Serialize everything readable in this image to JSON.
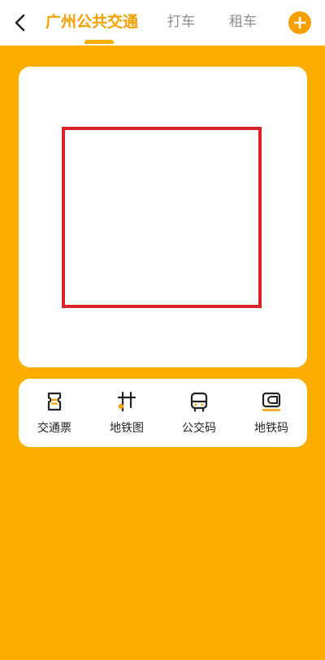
{
  "header": {
    "back_icon": "chevron-left-icon",
    "tabs": [
      {
        "label": "广州公共交通",
        "active": true
      },
      {
        "label": "打车",
        "active": false
      },
      {
        "label": "租车",
        "active": false
      }
    ],
    "add_icon": "plus-circle-icon"
  },
  "menu": {
    "items": [
      {
        "label": "交通票",
        "icon": "ticket-icon"
      },
      {
        "label": "地铁图",
        "icon": "metro-map-icon"
      },
      {
        "label": "公交码",
        "icon": "bus-icon"
      },
      {
        "label": "地铁码",
        "icon": "metro-card-icon"
      }
    ]
  },
  "colors": {
    "brand": "#FBAE00",
    "accent": "#F5A000",
    "qr_frame": "#D8232A"
  }
}
